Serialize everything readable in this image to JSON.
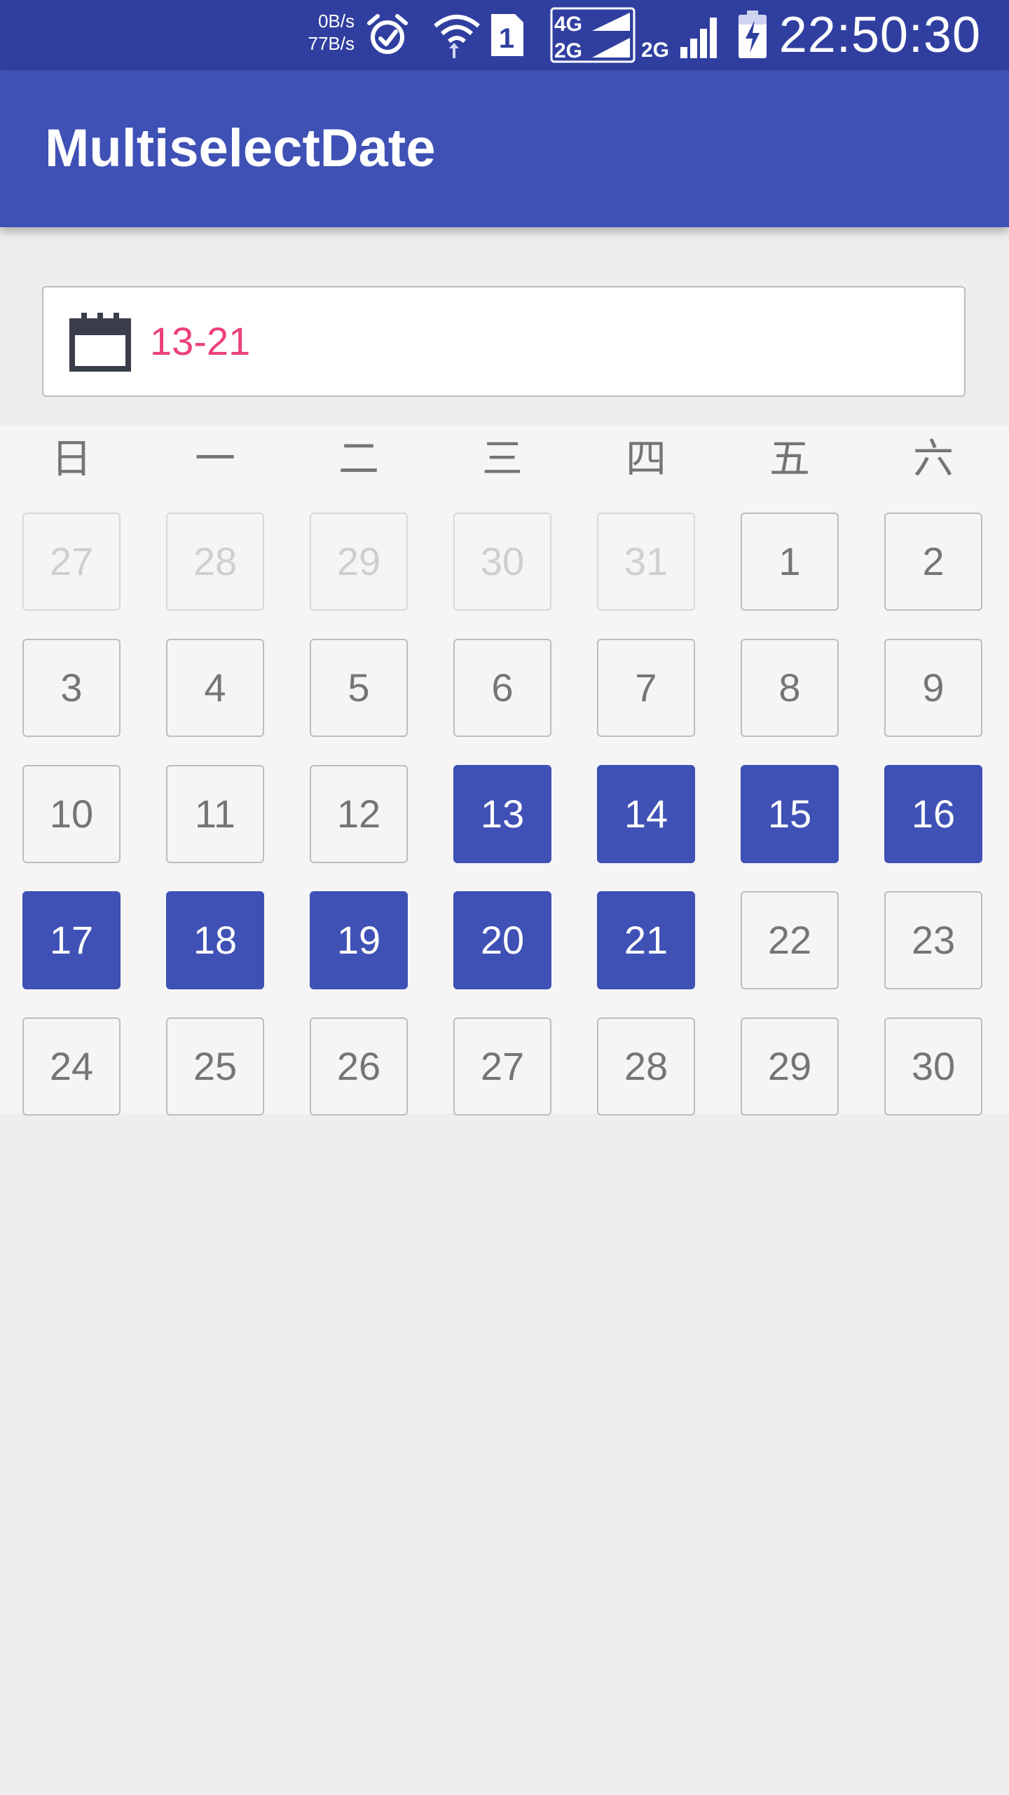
{
  "status_bar": {
    "net_speed_up": "0B/s",
    "net_speed_down": "77B/s",
    "network_label_1": "4G",
    "network_label_2": "2G",
    "network_label_3": "2G",
    "sim_slot": "1",
    "time": "22:50:30",
    "icons": [
      "alarm-icon",
      "wifi-icon",
      "sim-icon",
      "signal-4g-icon",
      "signal-2g-icon",
      "battery-charging-icon"
    ]
  },
  "app_bar": {
    "title": "MultiselectDate"
  },
  "date_field": {
    "icon": "calendar-icon",
    "value": "13-21"
  },
  "colors": {
    "primary": "#3f51b5",
    "primary_dark": "#303f9f",
    "accent": "#ec407a"
  },
  "calendar": {
    "weekdays": [
      "日",
      "一",
      "二",
      "三",
      "四",
      "五",
      "六"
    ],
    "selected_range": [
      "13",
      "21"
    ],
    "weeks": [
      [
        {
          "d": "27",
          "other": true
        },
        {
          "d": "28",
          "other": true
        },
        {
          "d": "29",
          "other": true
        },
        {
          "d": "30",
          "other": true
        },
        {
          "d": "31",
          "other": true
        },
        {
          "d": "1"
        },
        {
          "d": "2"
        }
      ],
      [
        {
          "d": "3"
        },
        {
          "d": "4"
        },
        {
          "d": "5"
        },
        {
          "d": "6"
        },
        {
          "d": "7"
        },
        {
          "d": "8"
        },
        {
          "d": "9"
        }
      ],
      [
        {
          "d": "10"
        },
        {
          "d": "11"
        },
        {
          "d": "12"
        },
        {
          "d": "13",
          "selected": true
        },
        {
          "d": "14",
          "selected": true
        },
        {
          "d": "15",
          "selected": true
        },
        {
          "d": "16",
          "selected": true
        }
      ],
      [
        {
          "d": "17",
          "selected": true
        },
        {
          "d": "18",
          "selected": true
        },
        {
          "d": "19",
          "selected": true
        },
        {
          "d": "20",
          "selected": true
        },
        {
          "d": "21",
          "selected": true
        },
        {
          "d": "22"
        },
        {
          "d": "23"
        }
      ],
      [
        {
          "d": "24"
        },
        {
          "d": "25"
        },
        {
          "d": "26"
        },
        {
          "d": "27"
        },
        {
          "d": "28"
        },
        {
          "d": "29"
        },
        {
          "d": "30"
        }
      ]
    ]
  }
}
